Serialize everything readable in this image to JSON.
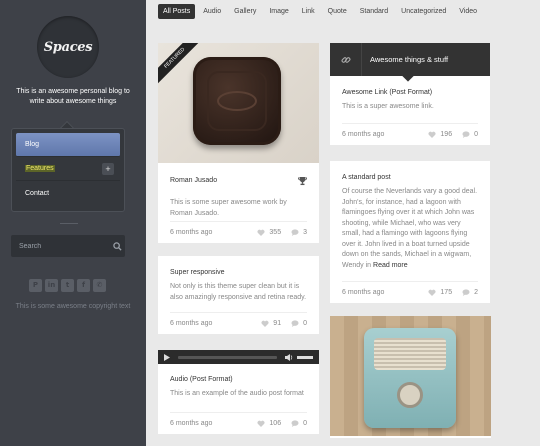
{
  "sidebar": {
    "logo": "Spaces",
    "tagline": "This is an awesome personal blog to write about awesome things",
    "menu": [
      {
        "label": "Blog"
      },
      {
        "label": "Features"
      },
      {
        "label": "Contact"
      }
    ],
    "search_placeholder": "Search",
    "social": [
      "P",
      "in",
      "t",
      "f",
      "✆"
    ],
    "copyright": "This is some awesome copyright text"
  },
  "filters": [
    "All Posts",
    "Audio",
    "Gallery",
    "Image",
    "Link",
    "Quote",
    "Standard",
    "Uncategorized",
    "Video"
  ],
  "posts": {
    "roman": {
      "ribbon": "FEATURED",
      "title": "Roman Jusado",
      "text": "This is some super awesome work by Roman Jusado.",
      "date": "6 months ago",
      "likes": "355",
      "comments": "3"
    },
    "super": {
      "title": "Super responsive",
      "text": "Not only is this theme super clean but it is also amazingly responsive and retina ready.",
      "date": "6 months ago",
      "likes": "91",
      "comments": "0"
    },
    "audio": {
      "title": "Audio (Post Format)",
      "text": "This is an example of the audio post format",
      "date": "6 months ago",
      "likes": "106",
      "comments": "0"
    },
    "link": {
      "header": "Awesome things & stuff",
      "title": "Awesome Link (Post Format)",
      "text": "This is a super awesome link.",
      "date": "6 months ago",
      "likes": "196",
      "comments": "0"
    },
    "standard": {
      "title": "A standard post",
      "text": "Of course the Neverlands vary a good deal. John's, for instance, had a lagoon with flamingoes flying over it at which John was shooting, while Michael, who was very small, had a flamingo with lagoons flying over it. John lived in a boat turned upside down on the sands, Michael in a wigwam, Wendy in",
      "more": "Read more",
      "date": "6 months ago",
      "likes": "175",
      "comments": "2"
    }
  }
}
